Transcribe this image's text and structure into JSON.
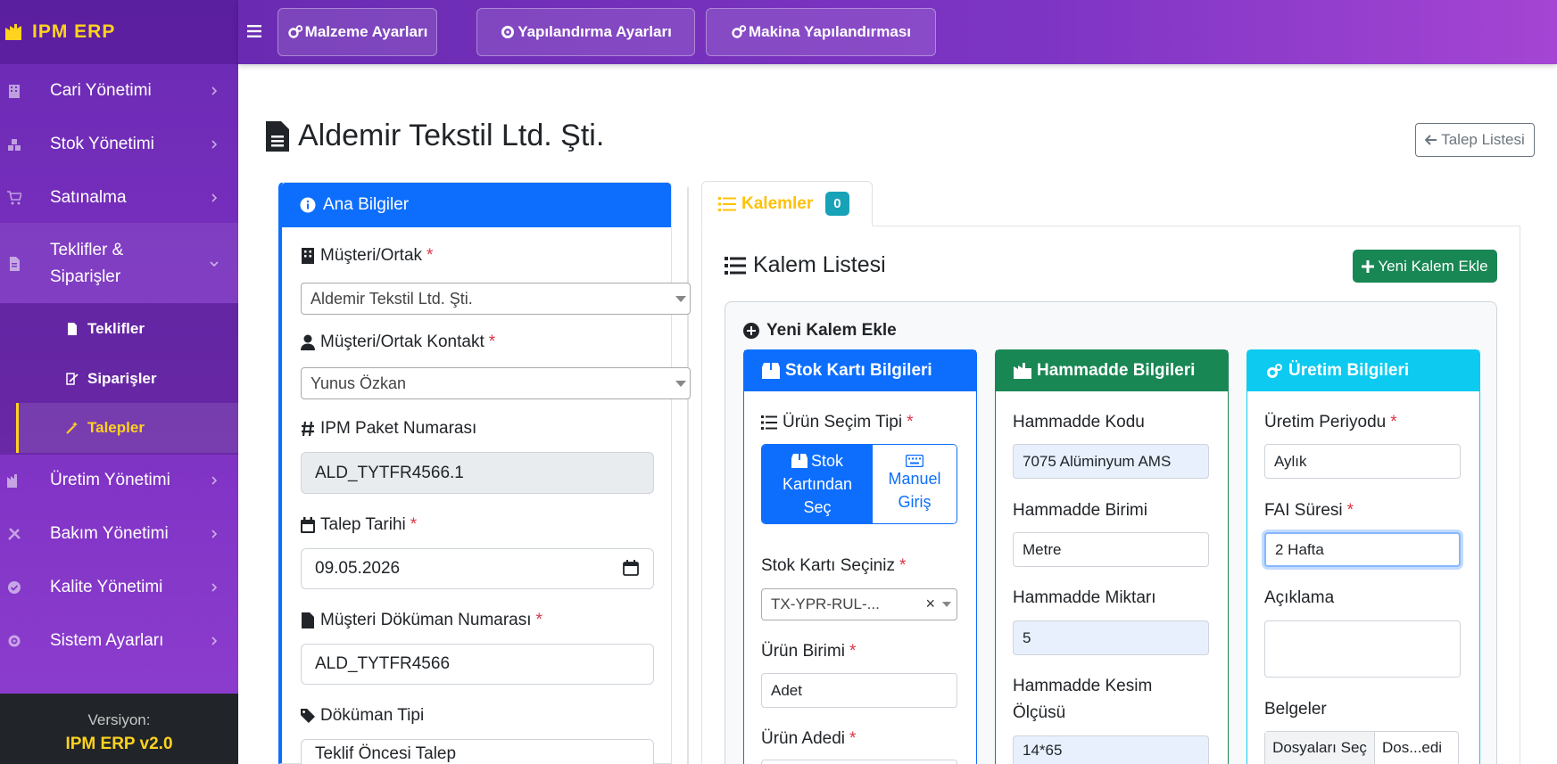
{
  "brand": {
    "name": "IPM ERP"
  },
  "sidebar": {
    "items": [
      {
        "label": "Cari Yönetimi",
        "icon": "building-icon"
      },
      {
        "label": "Stok Yönetimi",
        "icon": "boxes-icon"
      },
      {
        "label": "Satınalma",
        "icon": "cart-icon"
      },
      {
        "label": "Teklifler & Siparişler",
        "label_line1": "Teklifler &",
        "label_line2": "Siparişler",
        "icon": "file-invoice-icon"
      },
      {
        "label": "Üretim Yönetimi",
        "icon": "industry-icon"
      },
      {
        "label": "Bakım Yönetimi",
        "icon": "tools-icon"
      },
      {
        "label": "Kalite Yönetimi",
        "icon": "check-circle-icon"
      },
      {
        "label": "Sistem Ayarları",
        "icon": "gear-icon"
      }
    ],
    "sub_items": [
      {
        "label": "Teklifler",
        "icon": "file-icon"
      },
      {
        "label": "Siparişler",
        "icon": "signature-icon"
      },
      {
        "label": "Talepler",
        "icon": "magic-wand-icon"
      }
    ],
    "version_label": "Versiyon:",
    "version_value": "IPM ERP v2.0"
  },
  "topbar": {
    "buttons": [
      {
        "label": "Malzeme Ayarları",
        "icon": "cogs-icon"
      },
      {
        "label": "Yapılandırma Ayarları",
        "icon": "gear-icon"
      },
      {
        "label": "Makina Yapılandırması",
        "icon": "cogs-icon"
      }
    ]
  },
  "page": {
    "title": "Aldemir Tekstil Ltd. Şti.",
    "back_label": "Talep Listesi"
  },
  "main_info": {
    "header": "Ana Bilgiler",
    "customer_label": "Müşteri/Ortak",
    "customer_value": "Aldemir Tekstil Ltd. Şti.",
    "contact_label": "Müşteri/Ortak Kontakt",
    "contact_value": "Yunus Özkan",
    "package_label": "IPM Paket Numarası",
    "package_value": "ALD_TYTFR4566.1",
    "date_label": "Talep Tarihi",
    "date_value": "09.05.2026",
    "docnum_label": "Müşteri Döküman Numarası",
    "docnum_value": "ALD_TYTFR4566",
    "doctype_label": "Döküman Tipi",
    "doctype_value": "Teklif Öncesi Talep",
    "required_mark": "*"
  },
  "tabs": {
    "items_label": "Kalemler",
    "items_count": "0"
  },
  "item_list": {
    "title": "Kalem Listesi",
    "add_button": "Yeni Kalem Ekle",
    "new_item_title": "Yeni Kalem Ekle"
  },
  "stock_card": {
    "header": "Stok Kartı Bilgileri",
    "selection_label": "Ürün Seçim Tipi",
    "option_stock_line1": "Stok",
    "option_stock_line2": "Kartından",
    "option_stock_line3": "Seç",
    "option_manual_line1": "Manuel",
    "option_manual_line2": "Giriş",
    "select_label": "Stok Kartı Seçiniz",
    "select_value": "TX-YPR-RUL-...",
    "clear_mark": "×",
    "unit_label": "Ürün Birimi",
    "unit_value": "Adet",
    "qty_label": "Ürün Adedi"
  },
  "raw_material": {
    "header": "Hammadde Bilgileri",
    "code_label": "Hammadde Kodu",
    "code_value": "7075 Alüminyum AMS",
    "unit_label": "Hammadde Birimi",
    "unit_value": "Metre",
    "qty_label": "Hammadde Miktarı",
    "qty_value": "5",
    "cut_label_line1": "Hammadde Kesim",
    "cut_label_line2": "Ölçüsü",
    "cut_value": "14*65"
  },
  "production": {
    "header": "Üretim Bilgileri",
    "period_label": "Üretim Periyodu",
    "period_value": "Aylık",
    "fai_label": "FAI Süresi",
    "fai_value": "2 Hafta",
    "desc_label": "Açıklama",
    "docs_label": "Belgeler",
    "file_button": "Dosyaları Seç",
    "file_text": "Dos...edi"
  },
  "colors": {
    "primary": "#0d6efd",
    "success": "#198754",
    "info": "#0dcaf0",
    "warning": "#ffc107",
    "brand_yellow": "#ffd21f",
    "sidebar_purple": "#7a2fc0"
  }
}
